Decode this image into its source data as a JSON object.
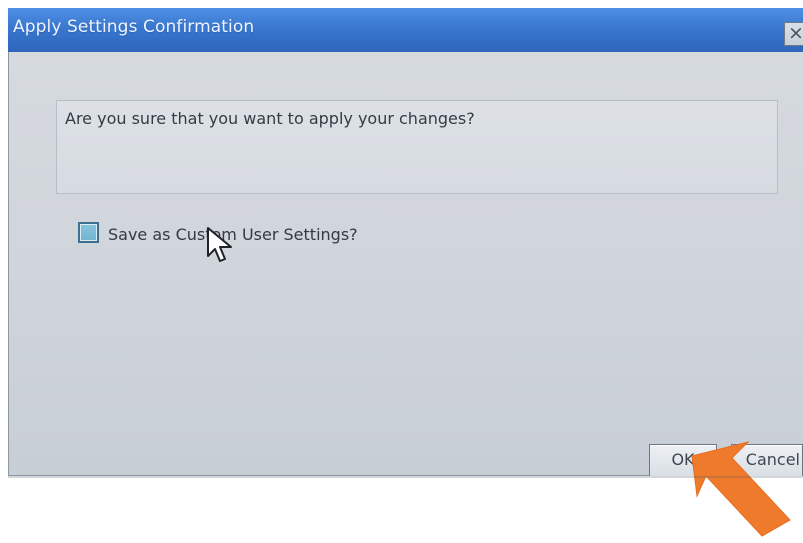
{
  "window": {
    "title": "Apply Settings Confirmation",
    "close_label": "×"
  },
  "message": {
    "text": "Are you sure that you want to apply your changes?"
  },
  "options": {
    "save_custom_label": "Save as Custom User Settings?",
    "save_custom_checked": false
  },
  "buttons": {
    "ok_label": "OK",
    "cancel_label": "Cancel"
  },
  "colors": {
    "title_bar": "#3876CF",
    "dialog_background": "#D0D5DB",
    "checkbox_fill": "#74B4D2",
    "annotation_arrow": "#F07A2B"
  },
  "icons": {
    "close": "close-icon",
    "cursor": "mouse-pointer-icon",
    "annotation": "arrow-annotation-icon"
  }
}
